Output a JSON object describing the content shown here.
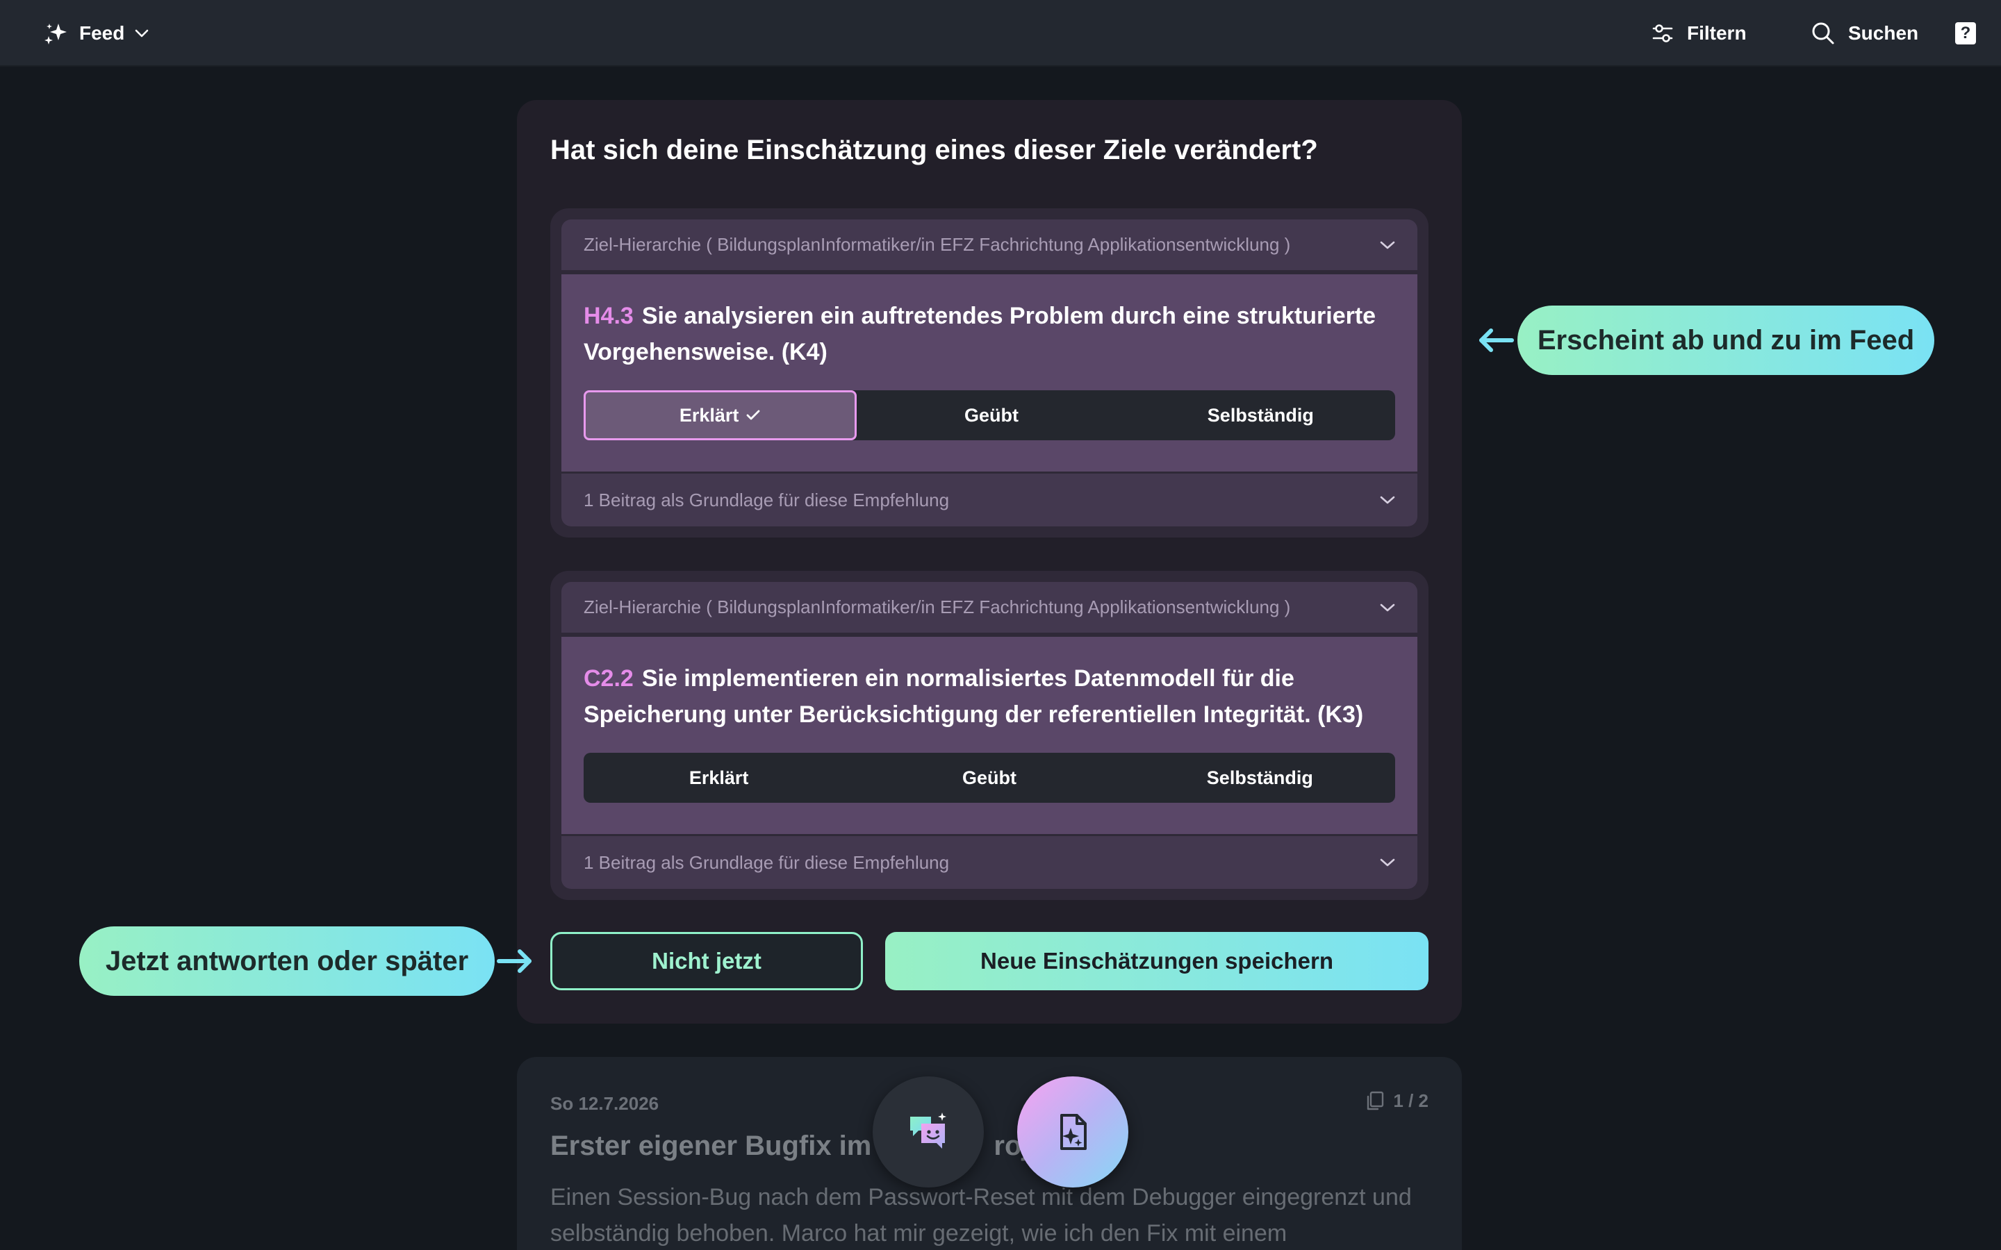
{
  "topbar": {
    "feed_label": "Feed",
    "filter_label": "Filtern",
    "search_label": "Suchen",
    "help_icon_text": "?"
  },
  "card": {
    "title": "Hat sich deine Einschätzung eines dieser Ziele verändert?",
    "goals": [
      {
        "hierarchy": "Ziel-Hierarchie ( BildungsplanInformatiker/in EFZ Fachrichtung Applikationsentwicklung )",
        "code": "H4.3",
        "text": "Sie analysieren ein auftretendes Problem durch eine strukturierte Vorgehensweise. (K4)",
        "options": [
          "Erklärt",
          "Geübt",
          "Selbständig"
        ],
        "selected": "Erklärt",
        "footer": "1 Beitrag als Grundlage für diese Empfehlung"
      },
      {
        "hierarchy": "Ziel-Hierarchie ( BildungsplanInformatiker/in EFZ Fachrichtung Applikationsentwicklung )",
        "code": "C2.2",
        "text": "Sie implementieren ein normalisiertes Datenmodell für die Speicherung unter Berücksichtigung der referentiellen Integrität. (K3)",
        "options": [
          "Erklärt",
          "Geübt",
          "Selbständig"
        ],
        "selected": null,
        "footer": "1 Beitrag als Grundlage für diese Empfehlung"
      }
    ],
    "later_label": "Nicht jetzt",
    "save_label": "Neue Einschätzungen speichern"
  },
  "next_card": {
    "date": "So 12.7.2026",
    "count": "1 / 2",
    "title": "Erster eigener Bugfix im K",
    "title_tail": "roje",
    "text": "Einen Session-Bug nach dem Passwort-Reset mit dem Debugger eingegrenzt und selbständig behoben. Marco hat mir gezeigt, wie ich den Fix mit einem"
  },
  "annotations": {
    "right": "Erscheint ab und zu im Feed",
    "left": "Jetzt antworten oder später"
  },
  "colors": {
    "background": "#14181e",
    "topbar": "#232830",
    "card": "#221f29",
    "goal_body": "#5a4768",
    "goal_header": "#43384f",
    "accent_pink": "#e58ce9",
    "accent_mint": "#98f0c4",
    "accent_cyan": "#7ae2f4"
  },
  "icons": {
    "feed": "sparkles-icon",
    "filter": "sliders-icon",
    "search": "search-icon",
    "help": "help-icon",
    "chevron": "chevron-down-icon",
    "check": "check-icon",
    "chat": "chat-smile-icon",
    "new_entry": "document-sparkle-icon",
    "arrow_left": "arrow-left-icon",
    "arrow_right": "arrow-right-icon"
  }
}
